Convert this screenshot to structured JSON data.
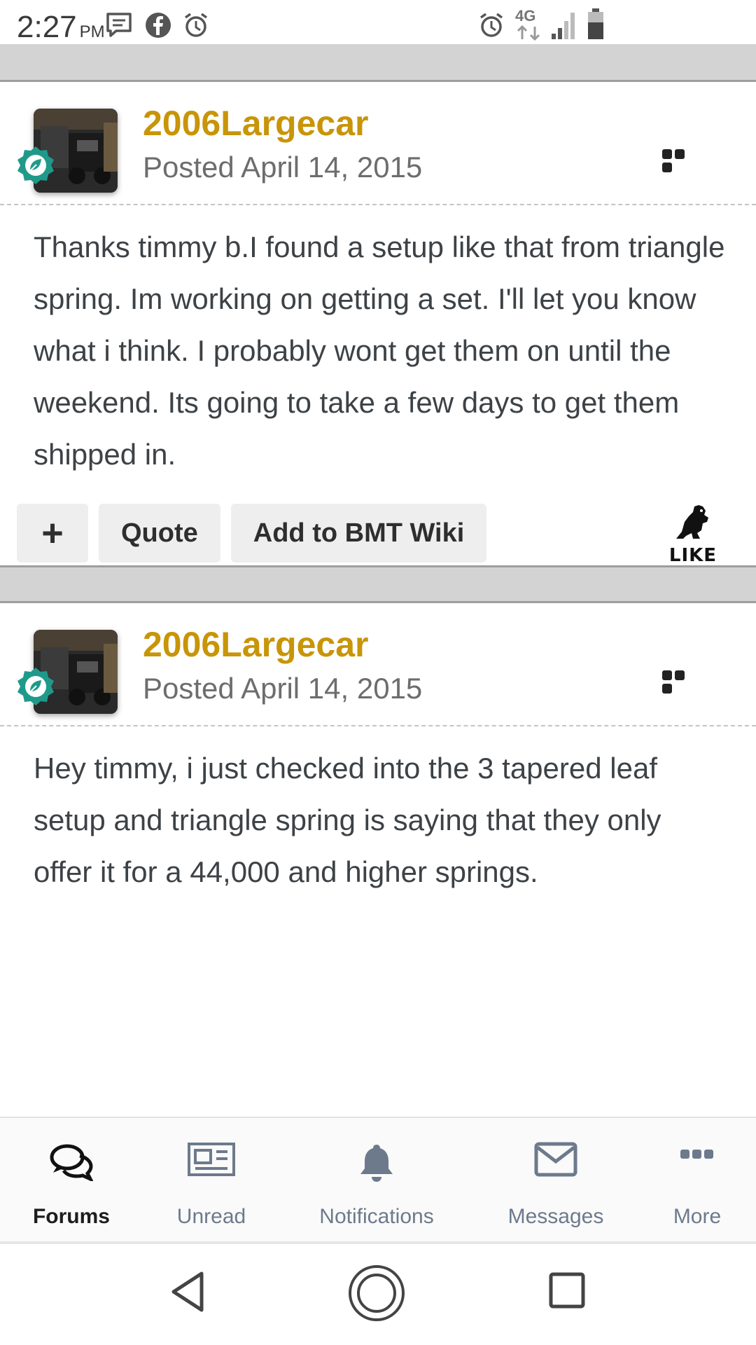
{
  "status_bar": {
    "time": "2:27",
    "ampm": "PM",
    "network": "4G",
    "icons": [
      "message-icon",
      "facebook-icon",
      "alarm-icon",
      "alarm-icon",
      "network-4g-icon",
      "signal-icon",
      "battery-icon"
    ]
  },
  "posts": [
    {
      "author": "2006Largecar",
      "posted": "Posted April 14, 2015",
      "body": "Thanks timmy b.I found a setup like that from triangle spring. Im working on getting a set. I'll let you know what i think. I probably wont get them on until the weekend. Its going to take a few days to get them shipped in.",
      "actions": {
        "plus": "+",
        "quote": "Quote",
        "wiki": "Add to BMT Wiki",
        "like": "LIKE"
      }
    },
    {
      "author": "2006Largecar",
      "posted": "Posted April 14, 2015",
      "body": "Hey timmy, i just checked into the 3 tapered leaf setup and triangle spring is saying that they only offer it for a 44,000 and higher springs."
    }
  ],
  "bottom_nav": {
    "items": [
      {
        "label": "Forums",
        "icon": "forums-icon",
        "active": true
      },
      {
        "label": "Unread",
        "icon": "newspaper-icon"
      },
      {
        "label": "Notifications",
        "icon": "bell-icon"
      },
      {
        "label": "Messages",
        "icon": "envelope-icon"
      },
      {
        "label": "More",
        "icon": "more-icon"
      }
    ]
  },
  "colors": {
    "author": "#c89508",
    "badge": "#1f9a8a",
    "nav_inactive": "#6d7a8c",
    "separator": "#d3d3d3"
  }
}
